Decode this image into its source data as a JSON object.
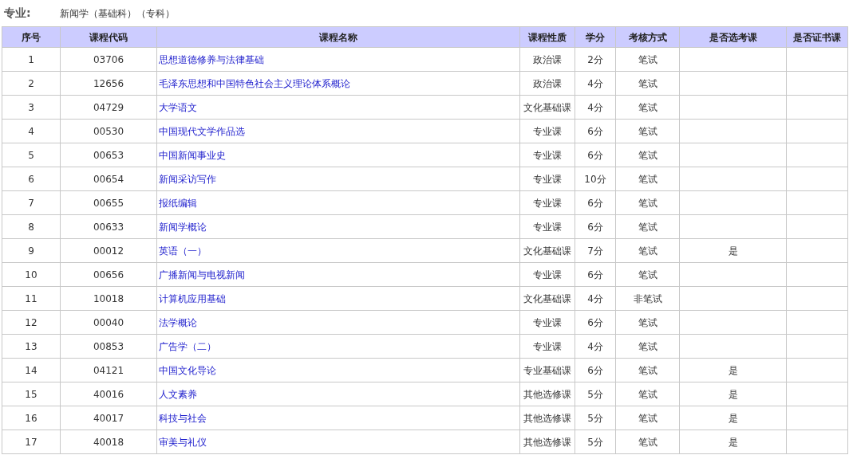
{
  "major": {
    "label": "专业:",
    "value": "新闻学（基础科）（专科）"
  },
  "table": {
    "columns": [
      "序号",
      "课程代码",
      "课程名称",
      "课程性质",
      "学分",
      "考核方式",
      "是否选考课",
      "是否证书课"
    ],
    "rows": [
      {
        "no": "1",
        "code": "03706",
        "name": "思想道德修养与法律基础",
        "type": "政治课",
        "credits": "2分",
        "exam": "笔试"
      },
      {
        "no": "2",
        "code": "12656",
        "name": "毛泽东思想和中国特色社会主义理论体系概论",
        "type": "政治课",
        "credits": "4分",
        "exam": "笔试"
      },
      {
        "no": "3",
        "code": "04729",
        "name": "大学语文",
        "type": "文化基础课",
        "credits": "4分",
        "exam": "笔试"
      },
      {
        "no": "4",
        "code": "00530",
        "name": "中国现代文学作品选",
        "type": "专业课",
        "credits": "6分",
        "exam": "笔试"
      },
      {
        "no": "5",
        "code": "00653",
        "name": "中国新闻事业史",
        "type": "专业课",
        "credits": "6分",
        "exam": "笔试"
      },
      {
        "no": "6",
        "code": "00654",
        "name": "新闻采访写作",
        "type": "专业课",
        "credits": "10分",
        "exam": "笔试"
      },
      {
        "no": "7",
        "code": "00655",
        "name": "报纸编辑",
        "type": "专业课",
        "credits": "6分",
        "exam": "笔试"
      },
      {
        "no": "8",
        "code": "00633",
        "name": "新闻学概论",
        "type": "专业课",
        "credits": "6分",
        "exam": "笔试"
      },
      {
        "no": "9",
        "code": "00012",
        "name": "英语（一）",
        "type": "文化基础课",
        "credits": "7分",
        "exam": "笔试",
        "elective": "是"
      },
      {
        "no": "10",
        "code": "00656",
        "name": "广播新闻与电视新闻",
        "type": "专业课",
        "credits": "6分",
        "exam": "笔试"
      },
      {
        "no": "11",
        "code": "10018",
        "name": "计算机应用基础",
        "type": "文化基础课",
        "credits": "4分",
        "exam": "非笔试"
      },
      {
        "no": "12",
        "code": "00040",
        "name": "法学概论",
        "type": "专业课",
        "credits": "6分",
        "exam": "笔试"
      },
      {
        "no": "13",
        "code": "00853",
        "name": "广告学（二）",
        "type": "专业课",
        "credits": "4分",
        "exam": "笔试"
      },
      {
        "no": "14",
        "code": "04121",
        "name": "中国文化导论",
        "type": "专业基础课",
        "credits": "6分",
        "exam": "笔试",
        "elective": "是"
      },
      {
        "no": "15",
        "code": "40016",
        "name": "人文素养",
        "type": "其他选修课",
        "credits": "5分",
        "exam": "笔试",
        "elective": "是"
      },
      {
        "no": "16",
        "code": "40017",
        "name": "科技与社会",
        "type": "其他选修课",
        "credits": "5分",
        "exam": "笔试",
        "elective": "是"
      },
      {
        "no": "17",
        "code": "40018",
        "name": "审美与礼仪",
        "type": "其他选修课",
        "credits": "5分",
        "exam": "笔试",
        "elective": "是"
      }
    ]
  }
}
